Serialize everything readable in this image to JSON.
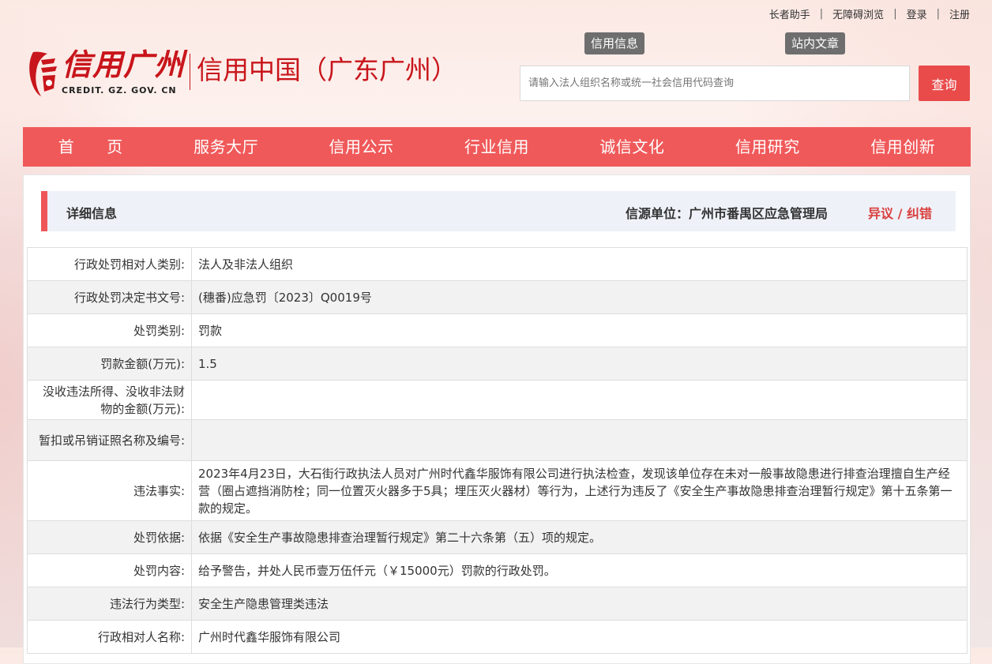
{
  "top_links": [
    "长者助手",
    "无障碍浏览",
    "登录",
    "注册"
  ],
  "logo": {
    "name_cn": "信用广州",
    "domain_en": "CREDIT. GZ. GOV. CN",
    "subtitle": "信用中国（广东广州）"
  },
  "tags": [
    "信用信息",
    "站内文章"
  ],
  "search": {
    "placeholder": "请输入法人组织名称或统一社会信用代码查询",
    "button_label": "查询"
  },
  "nav": [
    "首　　页",
    "服务大厅",
    "信用公示",
    "行业信用",
    "诚信文化",
    "信用研究",
    "信用创新"
  ],
  "detail": {
    "title": "详细信息",
    "source": "信源单位：广州市番禺区应急管理局",
    "objection": "异议 / 纠错"
  },
  "rows": [
    {
      "label": "行政处罚相对人类别:",
      "value": "法人及非法人组织"
    },
    {
      "label": "行政处罚决定书文号:",
      "value": "(穗番)应急罚〔2023〕Q0019号"
    },
    {
      "label": "处罚类别:",
      "value": "罚款"
    },
    {
      "label": "罚款金额(万元):",
      "value": "1.5"
    },
    {
      "label": "没收违法所得、没收非法财物的金额(万元):",
      "value": ""
    },
    {
      "label": "暂扣或吊销证照名称及编号:",
      "value": ""
    },
    {
      "label": "违法事实:",
      "value": "2023年4月23日，大石街行政执法人员对广州时代鑫华服饰有限公司进行执法检查，发现该单位存在未对一般事故隐患进行排查治理擅自生产经营（圈占遮挡消防栓；同一位置灭火器多于5具；埋压灭火器材）等行为，上述行为违反了《安全生产事故隐患排查治理暂行规定》第十五条第一款的规定。"
    },
    {
      "label": "处罚依据:",
      "value": "依据《安全生产事故隐患排查治理暂行规定》第二十六条第（五）项的规定。"
    },
    {
      "label": "处罚内容:",
      "value": "给予警告，并处人民币壹万伍仟元（￥15000元）罚款的行政处罚。"
    },
    {
      "label": "违法行为类型:",
      "value": "安全生产隐患管理类违法"
    },
    {
      "label": "行政相对人名称:",
      "value": "广州时代鑫华服饰有限公司"
    }
  ],
  "colors": {
    "brand_red": "#c8151b",
    "nav_red": "#f0595a",
    "accent_red": "#ef5657",
    "tag_gray": "#6e6e6e"
  }
}
